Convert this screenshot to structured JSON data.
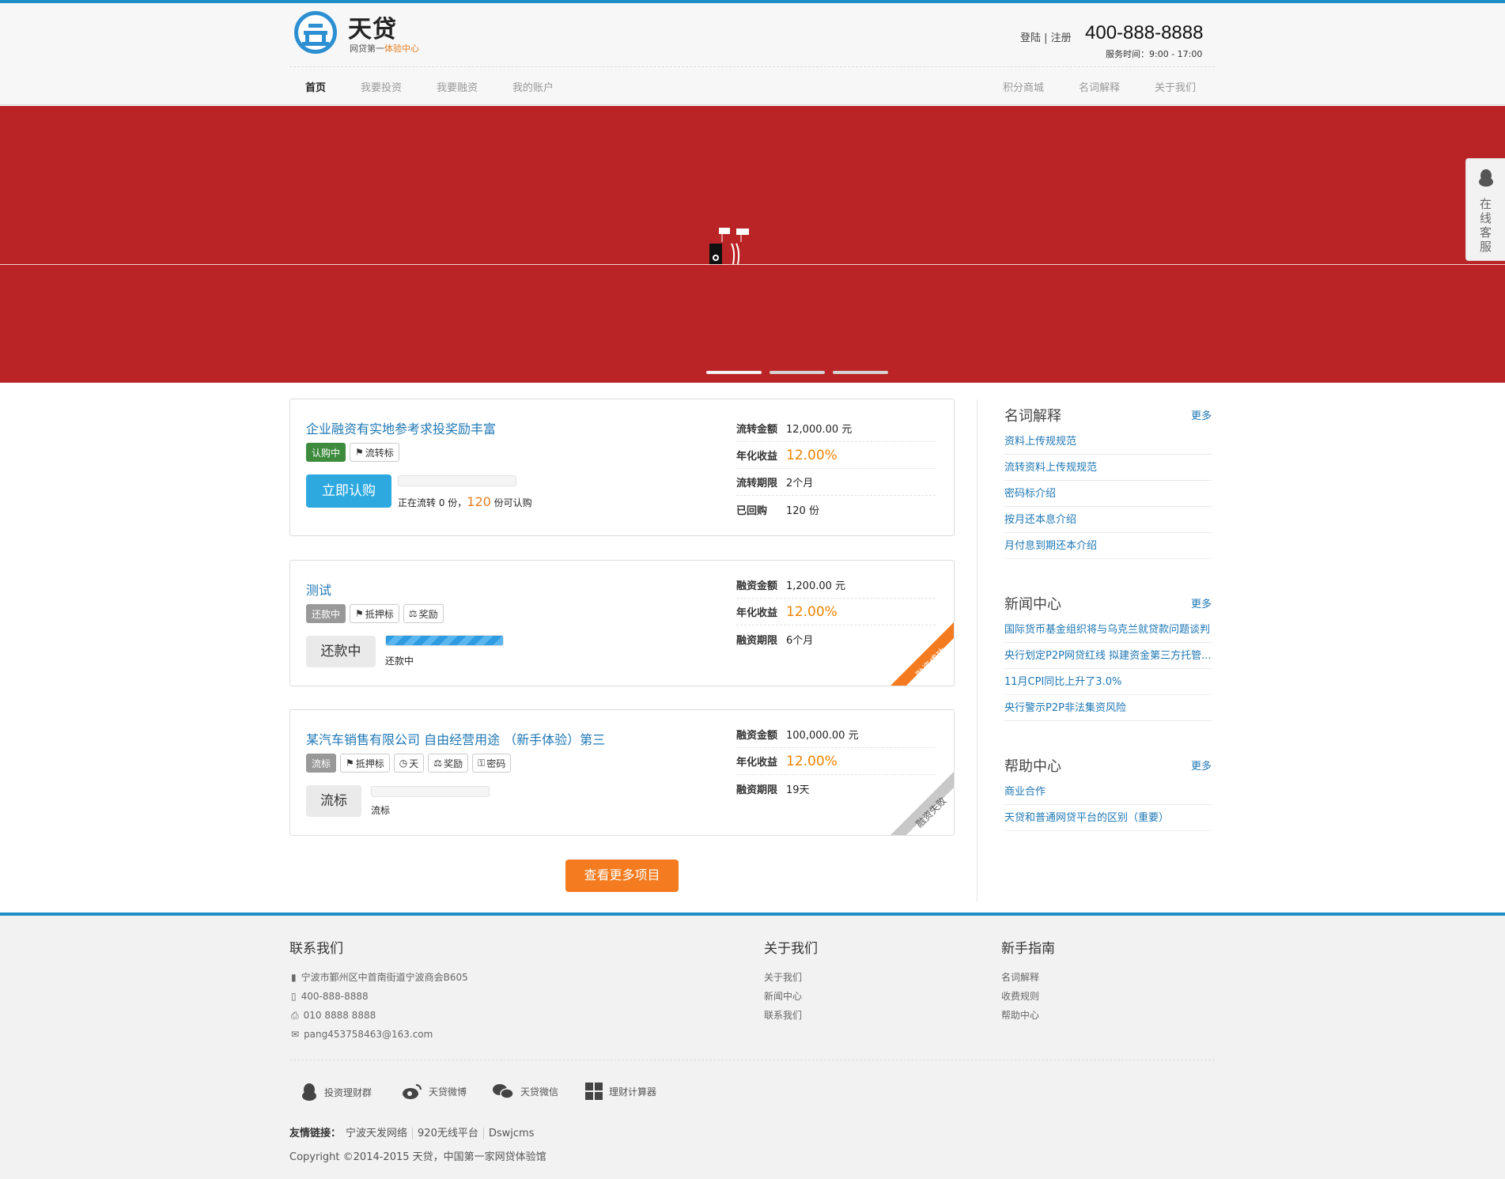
{
  "header": {
    "brand": "天贷",
    "tagline_a": "网贷第一",
    "tagline_b": "体验中心",
    "login": "登陆",
    "register": "注册",
    "phone": "400-888-8888",
    "service": "服务时间：9:00 - 17:00"
  },
  "nav": {
    "left": [
      "首页",
      "我要投资",
      "我要融资",
      "我的账户"
    ],
    "right": [
      "积分商城",
      "名词解释",
      "关于我们"
    ]
  },
  "customer_service": "在线客服",
  "projects": [
    {
      "title": "企业融资有实地参考求投奖励丰富",
      "tags": [
        "认购中",
        "流转标"
      ],
      "button": "立即认购",
      "progress_pct": 0,
      "progress_text_a": "正在流转 0 份，",
      "progress_text_b": "120",
      "progress_text_c": "份可认购",
      "info": [
        [
          "流转金额",
          "12,000.00 元"
        ],
        [
          "年化收益",
          "12.00%"
        ],
        [
          "流转期限",
          "2个月"
        ],
        [
          "已回购",
          "120 份"
        ]
      ]
    },
    {
      "title": "测试",
      "tags": [
        "还款中",
        "抵押标",
        "奖励"
      ],
      "button": "还款中",
      "progress_pct": 100,
      "progress_text": "还款中",
      "ribbon": "融资成功",
      "ribbon_color": "#f47b1f",
      "info": [
        [
          "融资金额",
          "1,200.00 元"
        ],
        [
          "年化收益",
          "12.00%"
        ],
        [
          "融资期限",
          "6个月"
        ]
      ]
    },
    {
      "title": "某汽车销售有限公司 自由经营用途 （新手体验）第三",
      "tags": [
        "流标",
        "抵押标",
        "天",
        "奖励",
        "密码"
      ],
      "button": "流标",
      "progress_pct": 0,
      "progress_text": "流标",
      "ribbon": "融资失败",
      "ribbon_color": "#c8c8c8",
      "info": [
        [
          "融资金额",
          "100,000.00 元"
        ],
        [
          "年化收益",
          "12.00%"
        ],
        [
          "融资期限",
          "19天"
        ]
      ]
    }
  ],
  "more_projects": "查看更多项目",
  "sidebar": {
    "more": "更多",
    "glossary": {
      "title": "名词解释",
      "items": [
        "资料上传规规范",
        "流转资料上传规规范",
        "密码标介绍",
        "按月还本息介绍",
        "月付息到期还本介绍"
      ]
    },
    "news": {
      "title": "新闻中心",
      "items": [
        "国际货币基金组织将与乌克兰就贷款问题谈判",
        "央行划定P2P网贷红线 拟建资金第三方托管...",
        "11月CPI同比上升了3.0%",
        "央行警示P2P非法集资风险"
      ]
    },
    "help": {
      "title": "帮助中心",
      "items": [
        "商业合作",
        "天贷和普通网贷平台的区别（重要）"
      ]
    }
  },
  "footer": {
    "contact_title": "联系我们",
    "address": "宁波市鄞州区中首南街道宁波商会B605",
    "mobile": "400-888-8888",
    "fax": "010 8888 8888",
    "email": "pang453758463@163.com",
    "about_title": "关于我们",
    "about_items": [
      "关于我们",
      "新闻中心",
      "联系我们"
    ],
    "guide_title": "新手指南",
    "guide_items": [
      "名词解释",
      "收费规则",
      "帮助中心"
    ],
    "social": [
      "投资理财群",
      "天贷微博",
      "天贷微信",
      "理财计算器"
    ],
    "friends_label": "友情链接：",
    "friends": [
      "宁波天发网络",
      "920无线平台",
      "Dswjcms"
    ],
    "copyright": "Copyright ©2014-2015 天贷，中国第一家网贷体验馆"
  }
}
